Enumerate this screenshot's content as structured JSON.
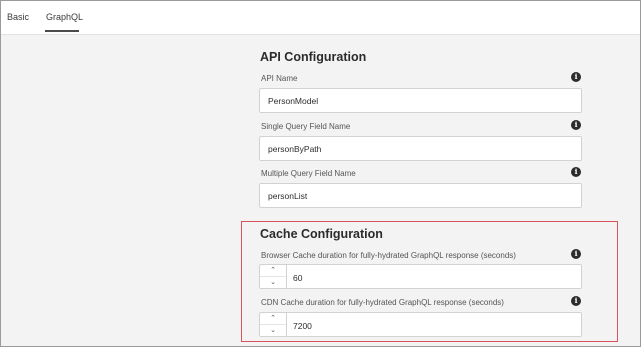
{
  "tabs": [
    {
      "label": "Basic"
    },
    {
      "label": "GraphQL"
    }
  ],
  "api_config": {
    "heading": "API Configuration",
    "api_name": {
      "label": "API Name",
      "value": "PersonModel"
    },
    "single_query": {
      "label": "Single Query Field Name",
      "value": "personByPath"
    },
    "multiple_query": {
      "label": "Multiple Query Field Name",
      "value": "personList"
    }
  },
  "cache_config": {
    "heading": "Cache Configuration",
    "browser_cache": {
      "label": "Browser Cache duration for fully-hydrated GraphQL response (seconds)",
      "value": "60"
    },
    "cdn_cache": {
      "label": "CDN Cache duration for fully-hydrated GraphQL response (seconds)",
      "value": "7200"
    }
  },
  "icons": {
    "info": "info-icon",
    "step_up": "chevron-up-icon",
    "step_down": "chevron-down-icon"
  },
  "colors": {
    "highlight_border": "#d9535c",
    "active_tab_underline": "#4b4b4b"
  }
}
